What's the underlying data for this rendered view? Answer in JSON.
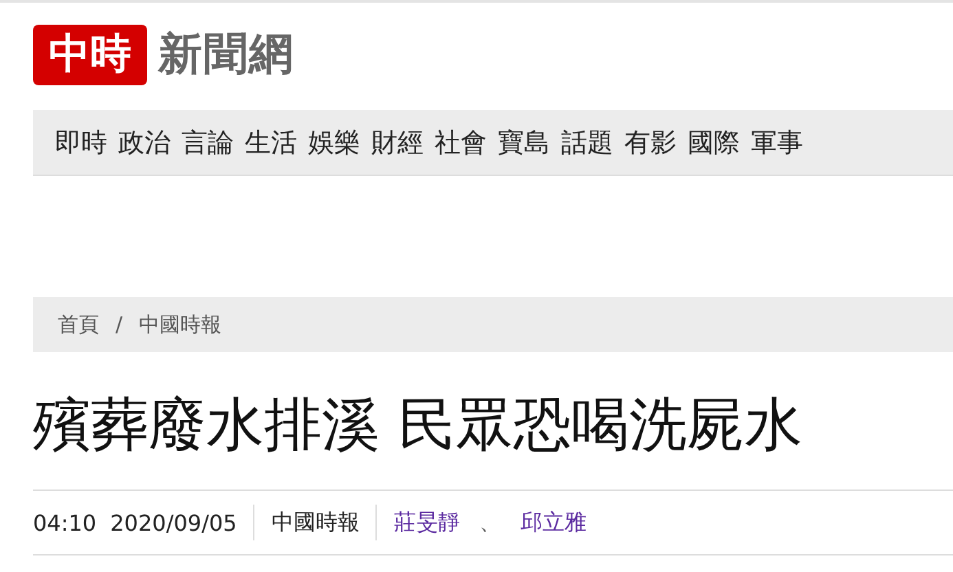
{
  "logo": {
    "mark": "中時",
    "name": "新聞網"
  },
  "nav": [
    {
      "label": "即時"
    },
    {
      "label": "政治"
    },
    {
      "label": "言論"
    },
    {
      "label": "生活"
    },
    {
      "label": "娛樂"
    },
    {
      "label": "財經"
    },
    {
      "label": "社會"
    },
    {
      "label": "寶島"
    },
    {
      "label": "話題"
    },
    {
      "label": "有影"
    },
    {
      "label": "國際"
    },
    {
      "label": "軍事"
    }
  ],
  "breadcrumb": [
    "首頁",
    "中國時報"
  ],
  "breadcrumb_separator": "/",
  "headline": "殯葬廢水排溪 民眾恐喝洗屍水",
  "meta": {
    "time": "04:10",
    "date": "2020/09/05",
    "source": "中國時報",
    "authors": [
      "莊旻靜",
      "邱立雅"
    ],
    "author_separator": "、"
  }
}
